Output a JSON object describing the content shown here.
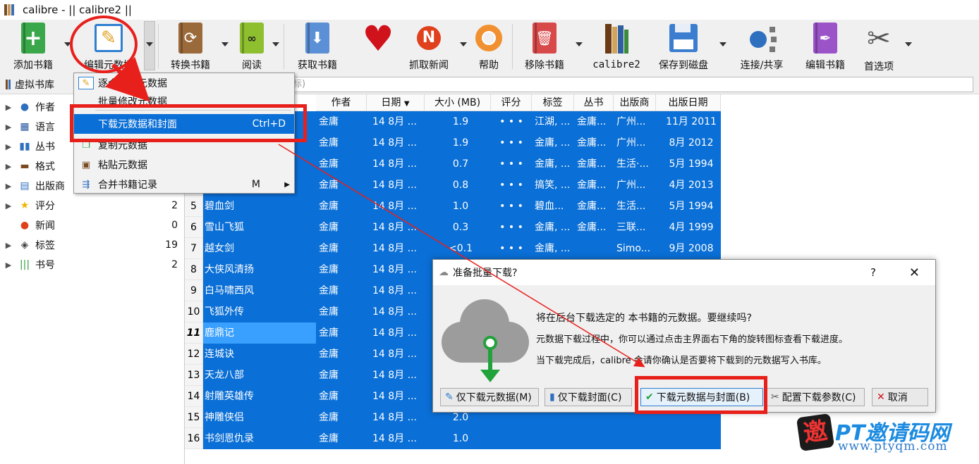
{
  "window": {
    "title": "calibre - || calibre2 ||"
  },
  "toolbar": {
    "items": [
      {
        "label": "添加书籍"
      },
      {
        "label": "编辑元数据"
      },
      {
        "label": "转换书籍"
      },
      {
        "label": "阅读"
      },
      {
        "label": "获取书籍"
      },
      {
        "label": ""
      },
      {
        "label": "抓取新闻"
      },
      {
        "label": "帮助"
      },
      {
        "label": "移除书籍"
      },
      {
        "label": "calibre2"
      },
      {
        "label": "保存到磁盘"
      },
      {
        "label": "连接/共享"
      },
      {
        "label": "编辑书籍"
      },
      {
        "label": "首选项"
      }
    ]
  },
  "virtual_library": {
    "label": "虚拟书库",
    "search_hint": "标)"
  },
  "tag_browser": {
    "items": [
      {
        "name": "作者",
        "count": ""
      },
      {
        "name": "语言",
        "count": ""
      },
      {
        "name": "丛书",
        "count": ""
      },
      {
        "name": "格式",
        "count": ""
      },
      {
        "name": "出版商",
        "count": ""
      },
      {
        "name": "评分",
        "count": "2"
      },
      {
        "name": "新闻",
        "count": "0"
      },
      {
        "name": "标签",
        "count": "19"
      },
      {
        "name": "书号",
        "count": "2"
      }
    ]
  },
  "table": {
    "columns": [
      "作者",
      "日期",
      "大小 (MB)",
      "评分",
      "标签",
      "丛书",
      "出版商",
      "出版日期"
    ],
    "rows": [
      {
        "num": "1",
        "title": "",
        "author": "金庸",
        "date": "14 8月 ...",
        "size": "1.9",
        "rating": "• • •",
        "tags": "江湖, ...",
        "series": "金庸...",
        "publisher": "广州...",
        "pubdate": "11月 2011"
      },
      {
        "num": "2",
        "title": "",
        "author": "金庸",
        "date": "14 8月 ...",
        "size": "1.9",
        "rating": "• • •",
        "tags": "金庸, ...",
        "series": "金庸...",
        "publisher": "广州...",
        "pubdate": "8月 2012"
      },
      {
        "num": "3",
        "title": "",
        "author": "金庸",
        "date": "14 8月 ...",
        "size": "0.7",
        "rating": "• • •",
        "tags": "金庸, ...",
        "series": "金庸...",
        "publisher": "生活·...",
        "pubdate": "5月 1994"
      },
      {
        "num": "4",
        "title": "",
        "author": "金庸",
        "date": "14 8月 ...",
        "size": "0.8",
        "rating": "• • •",
        "tags": "搞笑, ...",
        "series": "金庸...",
        "publisher": "广州...",
        "pubdate": "4月 2013"
      },
      {
        "num": "5",
        "title": "碧血剑",
        "author": "金庸",
        "date": "14 8月 ...",
        "size": "1.0",
        "rating": "• • •",
        "tags": "碧血...",
        "series": "金庸...",
        "publisher": "生活...",
        "pubdate": "5月 1994"
      },
      {
        "num": "6",
        "title": "雪山飞狐",
        "author": "金庸",
        "date": "14 8月 ...",
        "size": "0.3",
        "rating": "• • •",
        "tags": "金庸, ...",
        "series": "金庸...",
        "publisher": "三联...",
        "pubdate": "4月 1999"
      },
      {
        "num": "7",
        "title": "越女剑",
        "author": "金庸",
        "date": "14 8月 ...",
        "size": "<0.1",
        "rating": "• • •",
        "tags": "金庸, ...",
        "series": "",
        "publisher": "Simo...",
        "pubdate": "9月 2008"
      },
      {
        "num": "8",
        "title": "大侠风清扬",
        "author": "金庸",
        "date": "14 8月 ...",
        "size": "",
        "rating": "",
        "tags": "",
        "series": "",
        "publisher": "",
        "pubdate": ""
      },
      {
        "num": "9",
        "title": "白马啸西风",
        "author": "金庸",
        "date": "14 8月 ...",
        "size": "",
        "rating": "",
        "tags": "",
        "series": "",
        "publisher": "",
        "pubdate": ""
      },
      {
        "num": "10",
        "title": "飞狐外传",
        "author": "金庸",
        "date": "14 8月 ...",
        "size": "",
        "rating": "",
        "tags": "",
        "series": "",
        "publisher": "",
        "pubdate": ""
      },
      {
        "num": "11",
        "title": "鹿鼎记",
        "author": "金庸",
        "date": "14 8月 ...",
        "size": "",
        "rating": "",
        "tags": "",
        "series": "",
        "publisher": "",
        "pubdate": ""
      },
      {
        "num": "12",
        "title": "连城诀",
        "author": "金庸",
        "date": "14 8月 ...",
        "size": "",
        "rating": "",
        "tags": "",
        "series": "",
        "publisher": "",
        "pubdate": ""
      },
      {
        "num": "13",
        "title": "天龙八部",
        "author": "金庸",
        "date": "14 8月 ...",
        "size": "",
        "rating": "",
        "tags": "",
        "series": "",
        "publisher": "",
        "pubdate": ""
      },
      {
        "num": "14",
        "title": "射雕英雄传",
        "author": "金庸",
        "date": "14 8月 ...",
        "size": "",
        "rating": "",
        "tags": "",
        "series": "",
        "publisher": "",
        "pubdate": ""
      },
      {
        "num": "15",
        "title": "神雕侠侣",
        "author": "金庸",
        "date": "14 8月 ...",
        "size": "2.0",
        "rating": "",
        "tags": "",
        "series": "",
        "publisher": "",
        "pubdate": ""
      },
      {
        "num": "16",
        "title": "书剑恩仇录",
        "author": "金庸",
        "date": "14 8月 ...",
        "size": "1.0",
        "rating": "",
        "tags": "",
        "series": "",
        "publisher": "",
        "pubdate": ""
      }
    ]
  },
  "menu": {
    "items": [
      {
        "label": "逐个修改元数据",
        "shortcut": ""
      },
      {
        "label": "批量修改元数据",
        "shortcut": ""
      },
      {
        "label": "下载元数据和封面",
        "shortcut": "Ctrl+D"
      },
      {
        "label": "复制元数据",
        "shortcut": ""
      },
      {
        "label": "粘贴元数据",
        "shortcut": ""
      },
      {
        "label": "合并书籍记录",
        "shortcut": "M"
      }
    ]
  },
  "dialog": {
    "title": "准备批量下载?",
    "help": "?",
    "close": "✕",
    "line1": "将在后台下载选定的 本书籍的元数据。要继续吗?",
    "line2": "元数据下载过程中，你可以通过点击主界面右下角的旋转图标查看下载进度。",
    "line3": "当下载完成后，calibre 会请你确认是否要将下载到的元数据写入书库。",
    "buttons": {
      "meta_only": "仅下载元数据(M)",
      "cover_only": "仅下载封面(C)",
      "both": "下载元数据与封面(B)",
      "configure": "配置下载参数(C)",
      "cancel": "取消"
    }
  },
  "watermark": {
    "seal": "邀",
    "brand": "PT邀请码网",
    "site": "www.ptyqm.com"
  }
}
